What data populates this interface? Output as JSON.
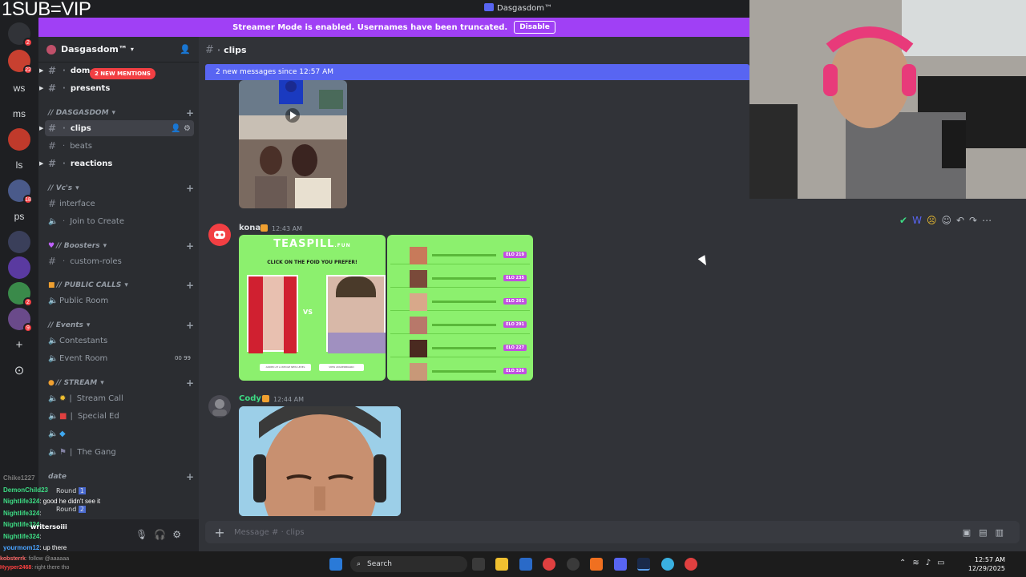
{
  "overlay": {
    "top_left_text": "1SUB=VIP"
  },
  "window": {
    "title": "Dasgasdom™"
  },
  "rail": {
    "servers": [
      {
        "label": "",
        "badge": "2",
        "color": "#313338"
      },
      {
        "label": "",
        "badge": "22",
        "color": "#c84030"
      },
      {
        "label": "ws",
        "badge": "",
        "color": "transparent"
      },
      {
        "label": "ms",
        "badge": "",
        "color": "transparent"
      },
      {
        "label": "",
        "badge": "",
        "color": "#c03a2b"
      },
      {
        "label": "ls",
        "badge": "",
        "color": "transparent"
      },
      {
        "label": "",
        "badge": "18",
        "color": "#4a5a8a"
      },
      {
        "label": "ps",
        "badge": "",
        "color": "transparent"
      },
      {
        "label": "",
        "badge": "",
        "color": "#3a3f5a"
      },
      {
        "label": "",
        "badge": "",
        "color": "#5a3aa0"
      },
      {
        "label": "",
        "badge": "2",
        "color": "#3a8a4a"
      },
      {
        "label": "",
        "badge": "9",
        "color": "#6a4a8a"
      }
    ],
    "add_server": "+",
    "explore": "⊙"
  },
  "banner": {
    "text": "Streamer Mode is enabled. Usernames have been truncated.",
    "button": "Disable"
  },
  "sidebar": {
    "guild_name": "Dasgasdom™",
    "mentions_pill": "2 NEW MENTIONS",
    "channels": {
      "dom": "dom-",
      "presents": "presents",
      "cat_dasgasdom": "// DASGASDOM",
      "clips": "clips",
      "beats": "beats",
      "reactions": "reactions",
      "cat_vcs": "// Vc's",
      "interface": "interface",
      "join_to_create": "Join to Create",
      "cat_boosters": "// Boosters",
      "custom_roles": "custom-roles",
      "cat_public_calls": "// PUBLIC CALLS",
      "public_room": "Public Room",
      "cat_events": "// Events",
      "contestants": "Contestants",
      "event_room": "Event Room",
      "event_room_counts": "00 99",
      "cat_stream": "// STREAM",
      "stream_call": "Stream Call",
      "special_ed": "Special Ed",
      "the_gang": "The Gang",
      "cat_date": "date"
    }
  },
  "chat_overlay": [
    {
      "user": "Chike1227",
      "text": "",
      "color": "#7a7a7a"
    },
    {
      "user": "DemonChild23",
      "text": "",
      "color": "#3ddc84"
    },
    {
      "user": "Nightlife324",
      "text": ": good he didn't see it",
      "color": "#3ddc84"
    },
    {
      "user": "Nightlife324",
      "text": ":",
      "color": "#3ddc84"
    },
    {
      "user": "Nightlife324",
      "text": ":",
      "color": "#3ddc84"
    },
    {
      "user": "Nightlife324",
      "text": ":",
      "color": "#3ddc84"
    },
    {
      "user": "yourmom12",
      "text": ": up there",
      "color": "#4aa3ff"
    },
    {
      "user": "kobsterrk",
      "text": ": follow @aaaaaa",
      "color": "#ff6b6b"
    },
    {
      "user": "Hyyper2468",
      "text": ": right there tho",
      "color": "#ff4040"
    }
  ],
  "chat_overlay_extra": {
    "round_a": "Round",
    "round_a_num": "1",
    "round_b": "Round",
    "round_b_num": "2",
    "writer": "writersoiii"
  },
  "main": {
    "channel_name": "clips",
    "new_messages": "2 new messages since 12:57 AM",
    "messages": [
      {
        "author": "kona",
        "time": "12:43 AM",
        "author_color": "#f2f3f5"
      },
      {
        "author": "Cody",
        "time": "12:44 AM",
        "author_color": "#3ddc84"
      }
    ],
    "teaspill": {
      "brand": "TEASPILL",
      "brand_suffix": ".FUN",
      "prompt": "CLICK ON THE FOID YOU PREFER!",
      "vs": "VS",
      "btn_a": "ADDED AT A WHOLE NEW LEVEL",
      "btn_b": "VIEW LEADERBOARD",
      "elos": [
        "ELO 219",
        "ELO 235",
        "ELO 261",
        "ELO 291",
        "ELO 227",
        "ELO 326"
      ]
    },
    "composer_placeholder": "Message # · clips"
  },
  "taskbar": {
    "search_label": "Search",
    "time": "12:57 AM",
    "date": "12/29/2025"
  },
  "colors": {
    "brand": "#5865f2",
    "banner": "#a040f5",
    "teaspill_green": "#8cf06e"
  }
}
